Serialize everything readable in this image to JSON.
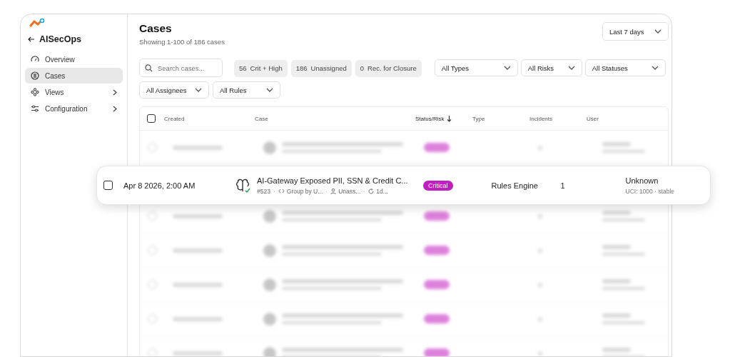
{
  "sidebar": {
    "back_label": "AISecOps",
    "items": [
      {
        "label": "Overview",
        "selected": false,
        "has_children": false
      },
      {
        "label": "Cases",
        "selected": true,
        "has_children": false
      },
      {
        "label": "Views",
        "selected": false,
        "has_children": true
      },
      {
        "label": "Configuration",
        "selected": false,
        "has_children": true
      }
    ]
  },
  "header": {
    "title": "Cases",
    "subtitle": "Showing 1-100 of 186 cases",
    "date_range": "Last 7 days"
  },
  "search": {
    "placeholder": "Search cases..."
  },
  "summary_chips": [
    {
      "count": "56",
      "label": "Crit + High"
    },
    {
      "count": "186",
      "label": "Unassigned"
    },
    {
      "count": "0",
      "label": "Rec. for Closure"
    }
  ],
  "filters": [
    {
      "label": "All Types"
    },
    {
      "label": "All Risks"
    },
    {
      "label": "All Statuses"
    },
    {
      "label": "All Assignees"
    },
    {
      "label": "All Rules"
    }
  ],
  "table": {
    "select_all_checked": false,
    "columns": [
      {
        "label": "Created",
        "sorted": false
      },
      {
        "label": "Case",
        "sorted": false
      },
      {
        "label": "Status/Risk",
        "sorted": true
      },
      {
        "label": "Type",
        "sorted": false
      },
      {
        "label": "Incidents",
        "sorted": false
      },
      {
        "label": "User",
        "sorted": false
      }
    ]
  },
  "highlighted_row": {
    "checked": false,
    "created": "Apr 8 2026, 2:00 AM",
    "title": "AI-Gateway Exposed PII, SSN & Credit C...",
    "id": "#523",
    "meta_separator": "·",
    "group": "Group by U...",
    "assignee": "Unass...",
    "age": "1d...",
    "status": "Critical",
    "type": "Rules Engine",
    "incidents": "1",
    "user": "Unknown",
    "user_detail": "UCI: 1000 · stable"
  }
}
